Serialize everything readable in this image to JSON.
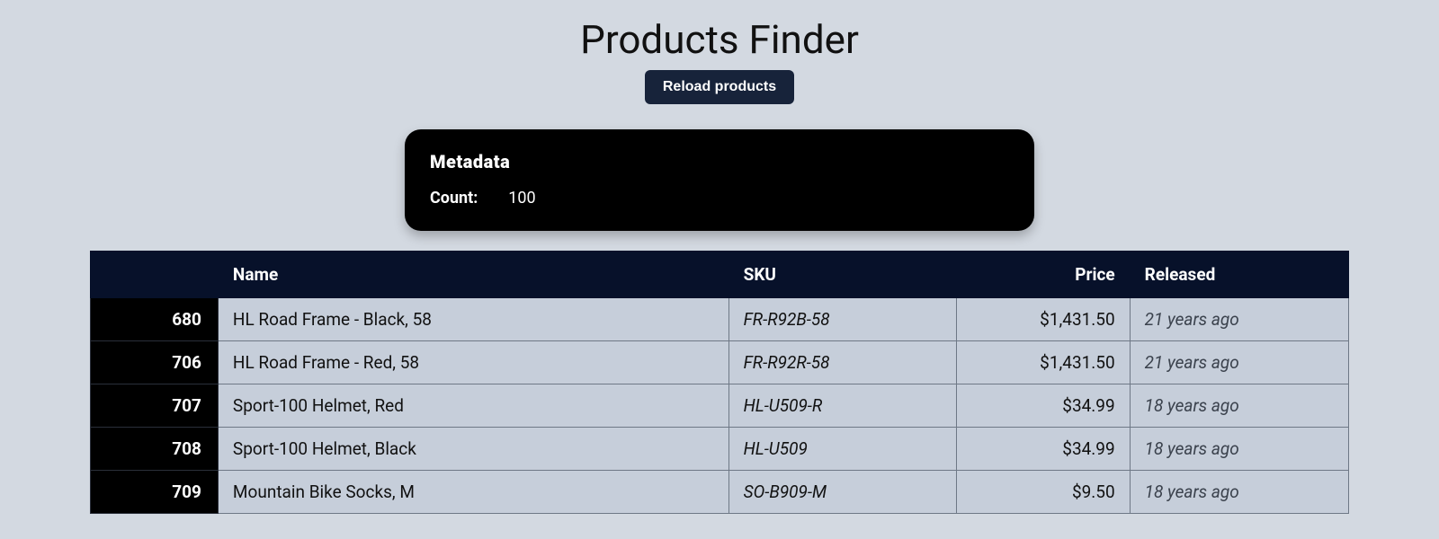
{
  "page": {
    "title": "Products Finder",
    "reload_label": "Reload products"
  },
  "metadata": {
    "heading": "Metadata",
    "count_label": "Count:",
    "count_value": "100"
  },
  "table": {
    "headers": {
      "id": "",
      "name": "Name",
      "sku": "SKU",
      "price": "Price",
      "released": "Released"
    },
    "rows": [
      {
        "id": "680",
        "name": "HL Road Frame - Black, 58",
        "sku": "FR-R92B-58",
        "price": "$1,431.50",
        "released": "21 years ago"
      },
      {
        "id": "706",
        "name": "HL Road Frame - Red, 58",
        "sku": "FR-R92R-58",
        "price": "$1,431.50",
        "released": "21 years ago"
      },
      {
        "id": "707",
        "name": "Sport-100 Helmet, Red",
        "sku": "HL-U509-R",
        "price": "$34.99",
        "released": "18 years ago"
      },
      {
        "id": "708",
        "name": "Sport-100 Helmet, Black",
        "sku": "HL-U509",
        "price": "$34.99",
        "released": "18 years ago"
      },
      {
        "id": "709",
        "name": "Mountain Bike Socks, M",
        "sku": "SO-B909-M",
        "price": "$9.50",
        "released": "18 years ago"
      }
    ]
  }
}
